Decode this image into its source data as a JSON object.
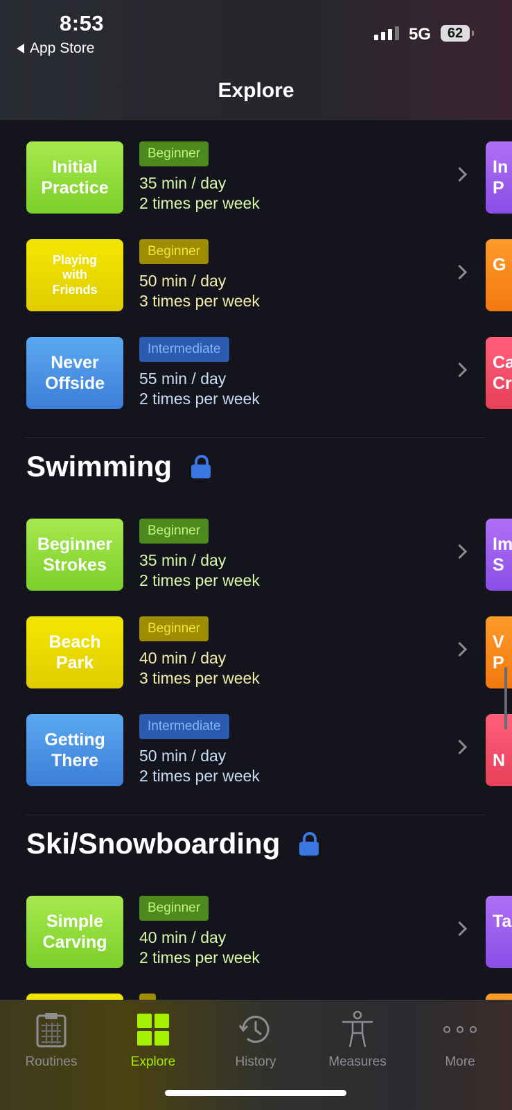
{
  "status_bar": {
    "time": "8:53",
    "back_label": "App Store",
    "network": "5G",
    "battery": "62"
  },
  "header": {
    "title": "Explore"
  },
  "groups": [
    {
      "name": "",
      "items": [
        {
          "title": "Initial Practice",
          "level": "Beginner",
          "duration": "35 min / day",
          "frequency": "2 times per week",
          "peek": "In\nP"
        },
        {
          "title": "Playing with Friends",
          "level": "Beginner",
          "duration": "50 min / day",
          "frequency": "3 times per week",
          "peek": "G"
        },
        {
          "title": "Never Offside",
          "level": "Intermediate",
          "duration": "55 min / day",
          "frequency": "2 times per week",
          "peek": "Ca\nCr"
        }
      ]
    },
    {
      "name": "Swimming",
      "items": [
        {
          "title": "Beginner Strokes",
          "level": "Beginner",
          "duration": "35 min / day",
          "frequency": "2 times per week",
          "peek": "Im\nS"
        },
        {
          "title": "Beach Park",
          "level": "Beginner",
          "duration": "40 min / day",
          "frequency": "3 times per week",
          "peek": "V\nP"
        },
        {
          "title": "Getting There",
          "level": "Intermediate",
          "duration": "50 min / day",
          "frequency": "2 times per week",
          "peek": "\nN"
        }
      ]
    },
    {
      "name": "Ski/Snowboarding",
      "items": [
        {
          "title": "Simple Carving",
          "level": "Beginner",
          "duration": "40 min / day",
          "frequency": "2 times per week",
          "peek": "Ta"
        }
      ]
    }
  ],
  "tabs": [
    {
      "label": "Routines",
      "icon": "clipboard-icon",
      "active": false
    },
    {
      "label": "Explore",
      "icon": "grid-icon",
      "active": true
    },
    {
      "label": "History",
      "icon": "history-clock-icon",
      "active": false
    },
    {
      "label": "Measures",
      "icon": "body-figure-icon",
      "active": false
    },
    {
      "label": "More",
      "icon": "more-dots-icon",
      "active": false
    }
  ],
  "colors": {
    "background": "#14151c",
    "accent": "#a5f000",
    "lock": "#3a78e0"
  }
}
